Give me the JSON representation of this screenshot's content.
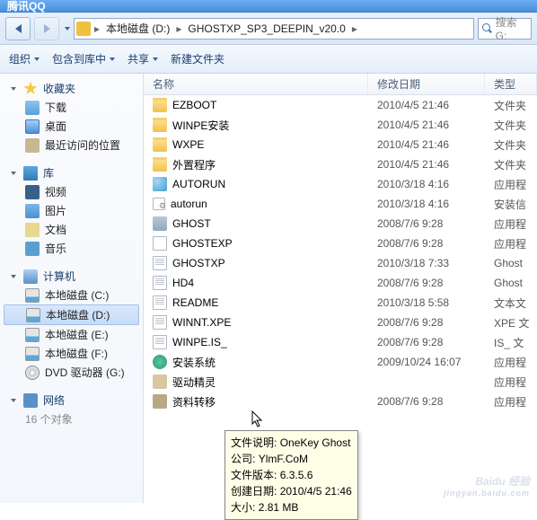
{
  "titlebar": {
    "app": "腾讯QQ"
  },
  "address": {
    "seg1": "本地磁盘 (D:)",
    "seg2": "GHOSTXP_SP3_DEEPIN_v20.0"
  },
  "search": {
    "placeholder": "搜索 G:"
  },
  "toolbar": {
    "organize": "组织",
    "include": "包含到库中",
    "share": "共享",
    "newfolder": "新建文件夹"
  },
  "sidebar": {
    "fav": "收藏夹",
    "dl": "下载",
    "desk": "桌面",
    "recent": "最近访问的位置",
    "lib": "库",
    "vid": "视频",
    "pic": "图片",
    "doc": "文档",
    "mus": "音乐",
    "comp": "计算机",
    "c": "本地磁盘 (C:)",
    "d": "本地磁盘 (D:)",
    "e": "本地磁盘 (E:)",
    "f": "本地磁盘 (F:)",
    "dvd": "DVD 驱动器 (G:)",
    "net": "网络",
    "extra": "16 个对象"
  },
  "columns": {
    "name": "名称",
    "date": "修改日期",
    "type": "类型"
  },
  "files": [
    {
      "icon": "folder",
      "name": "EZBOOT",
      "date": "2010/4/5 21:46",
      "type": "文件夹"
    },
    {
      "icon": "folder",
      "name": "WINPE安装",
      "date": "2010/4/5 21:46",
      "type": "文件夹"
    },
    {
      "icon": "folder",
      "name": "WXPE",
      "date": "2010/4/5 21:46",
      "type": "文件夹"
    },
    {
      "icon": "folder",
      "name": "外置程序",
      "date": "2010/4/5 21:46",
      "type": "文件夹"
    },
    {
      "icon": "app",
      "name": "AUTORUN",
      "date": "2010/3/18 4:16",
      "type": "应用程"
    },
    {
      "icon": "cfg",
      "name": "autorun",
      "date": "2010/3/18 4:16",
      "type": "安装信"
    },
    {
      "icon": "ghost",
      "name": "GHOST",
      "date": "2008/7/6 9:28",
      "type": "应用程"
    },
    {
      "icon": "exe",
      "name": "GHOSTEXP",
      "date": "2008/7/6 9:28",
      "type": "应用程"
    },
    {
      "icon": "txt",
      "name": "GHOSTXP",
      "date": "2010/3/18 7:33",
      "type": "Ghost"
    },
    {
      "icon": "txt",
      "name": "HD4",
      "date": "2008/7/6 9:28",
      "type": "Ghost"
    },
    {
      "icon": "txt",
      "name": "README",
      "date": "2010/3/18 5:58",
      "type": "文本文"
    },
    {
      "icon": "txt",
      "name": "WINNT.XPE",
      "date": "2008/7/6 9:28",
      "type": "XPE 文"
    },
    {
      "icon": "txt",
      "name": "WINPE.IS_",
      "date": "2008/7/6 9:28",
      "type": "IS_ 文"
    },
    {
      "icon": "inst",
      "name": "安装系统",
      "date": "2009/10/24 16:07",
      "type": "应用程"
    },
    {
      "icon": "drv",
      "name": "驱动精灵",
      "date": "",
      "type": "应用程"
    },
    {
      "icon": "data",
      "name": "资料转移",
      "date": "2008/7/6 9:28",
      "type": "应用程"
    }
  ],
  "tooltip": {
    "l1_k": "文件说明:",
    "l1_v": "OneKey Ghost",
    "l2_k": "公司:",
    "l2_v": "YlmF.CoM",
    "l3_k": "文件版本:",
    "l3_v": "6.3.5.6",
    "l4_k": "创建日期:",
    "l4_v": "2010/4/5 21:46",
    "l5_k": "大小:",
    "l5_v": "2.81 MB"
  },
  "watermark": {
    "main": "Baidu 经验",
    "sub": "jingyan.baidu.com"
  }
}
